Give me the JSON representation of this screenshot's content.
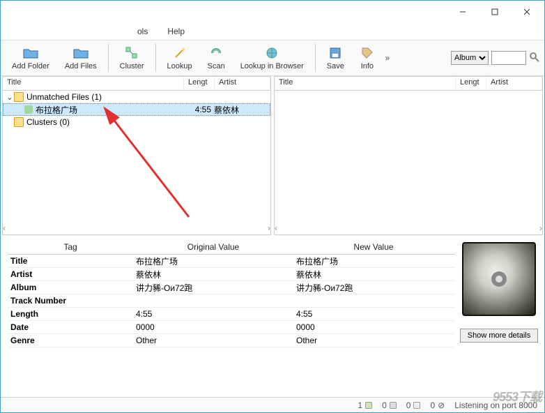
{
  "menu": {
    "tools": "ols",
    "help": "Help"
  },
  "toolbar": {
    "addFolder": "Add Folder",
    "addFiles": "Add Files",
    "cluster": "Cluster",
    "lookup": "Lookup",
    "scan": "Scan",
    "lookupBrowser": "Lookup in Browser",
    "save": "Save",
    "info": "Info",
    "selectValue": "Album"
  },
  "columns": {
    "title": "Title",
    "length": "Lengt",
    "artist": "Artist"
  },
  "leftTree": {
    "unmatched": "Unmatched Files (1)",
    "selectedTrack": "布拉格广场",
    "selectedLen": "4:55",
    "selectedArtist": "蔡依林",
    "clusters": "Clusters (0)"
  },
  "detailsHeader": {
    "tag": "Tag",
    "orig": "Original Value",
    "newv": "New Value"
  },
  "rows": [
    {
      "tag": "Title",
      "o": "布拉格广场",
      "n": "布拉格广场"
    },
    {
      "tag": "Artist",
      "o": "蔡依林",
      "n": "蔡依林"
    },
    {
      "tag": "Album",
      "o": "讲力豨-Ои72跑",
      "n": "讲力豨-Ои72跑"
    },
    {
      "tag": "Track Number",
      "o": "",
      "n": ""
    },
    {
      "tag": "Length",
      "o": "4:55",
      "n": "4:55"
    },
    {
      "tag": "Date",
      "o": "0000",
      "n": "0000"
    },
    {
      "tag": "Genre",
      "o": "Other",
      "n": "Other"
    }
  ],
  "showMore": "Show more details",
  "status": {
    "c1": "1",
    "c2": "0",
    "c3": "0",
    "c4": "0",
    "listening": "Listening on port 8000"
  }
}
